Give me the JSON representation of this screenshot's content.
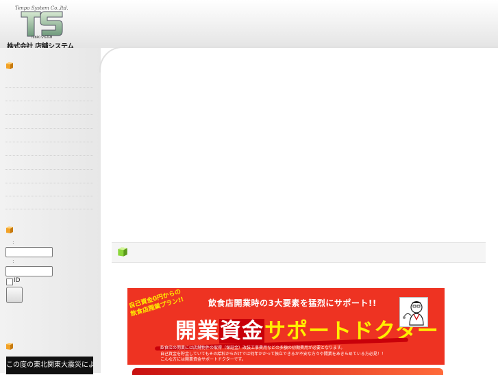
{
  "header": {
    "company_en": "Tenpo System Co.,ltd.",
    "company_ja": "株式会社 店舗システム",
    "logo_mark": "TS",
    "logo_caption": "TENPO SYSTEM"
  },
  "sidebar": {
    "login": {
      "id_colon": ":",
      "password_colon": ":",
      "remember_label": "ID"
    },
    "news": {
      "text": "この度の東北関東大震災により"
    }
  },
  "banner": {
    "tag_line1": "自己資金0円からの",
    "tag_line2": "飲食店開業プラン!!",
    "title": "飲食店開業時の3大要素を猛烈にサポート!!",
    "main_part1": "開業",
    "main_part2": "資金",
    "main_part3": "サポートドクター",
    "foot_line1": "飲食店の開業には店舗物件の取得（保証金）改装工事費用などの多額の初期費用が必要となります。",
    "foot_line2": "自己資金を貯金していてもその給料からだけでは何年かかって独立できるか不安な方々や開業をあきらめている方必見！！",
    "foot_line3": "こんな方には開業資金サポートドクターです。"
  },
  "colors": {
    "banner_red": "#ee3322",
    "banner_yellow": "#ffee00",
    "cube_orange": "#f2a227",
    "cube_green": "#8bd63a"
  },
  "icons": {
    "cube": "cube-bullet-icon",
    "doctor": "doctor-illustration-icon"
  }
}
